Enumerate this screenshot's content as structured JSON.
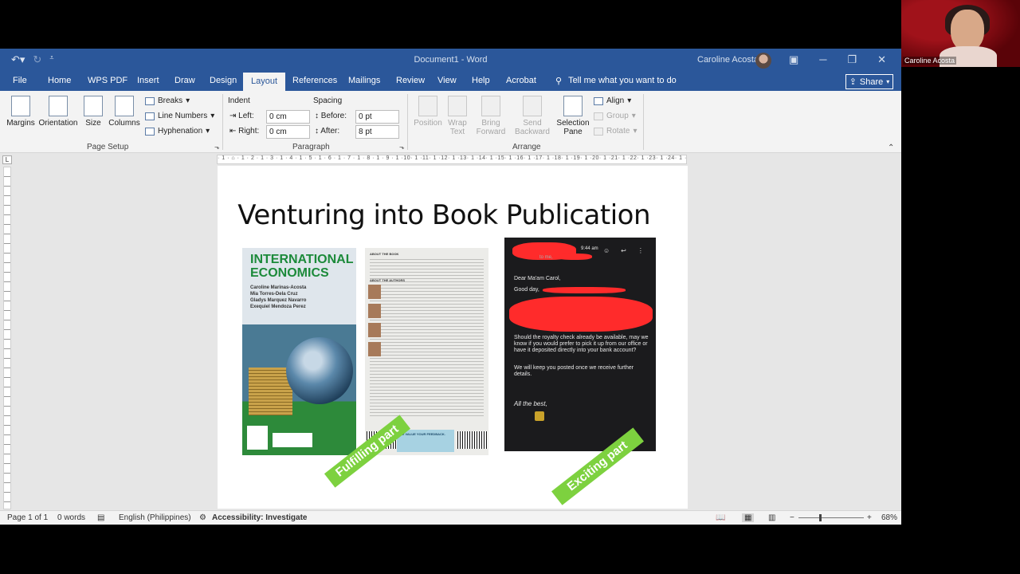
{
  "app": {
    "doc_title": "Document1  -  Word",
    "user_name": "Caroline Acosta"
  },
  "tabs": [
    "File",
    "Home",
    "WPS PDF",
    "Insert",
    "Draw",
    "Design",
    "Layout",
    "References",
    "Mailings",
    "Review",
    "View",
    "Help",
    "Acrobat"
  ],
  "tell_me": "Tell me what you want to do",
  "share_label": "Share",
  "ribbon": {
    "page_setup": {
      "group_label": "Page Setup",
      "margins": "Margins",
      "orientation": "Orientation",
      "size": "Size",
      "columns": "Columns",
      "breaks": "Breaks",
      "line_numbers": "Line Numbers",
      "hyphenation": "Hyphenation"
    },
    "paragraph": {
      "group_label": "Paragraph",
      "indent_label": "Indent",
      "spacing_label": "Spacing",
      "left_label": "Left:",
      "left_value": "0 cm",
      "right_label": "Right:",
      "right_value": "0 cm",
      "before_label": "Before:",
      "before_value": "0 pt",
      "after_label": "After:",
      "after_value": "8 pt"
    },
    "arrange": {
      "group_label": "Arrange",
      "position": "Position",
      "wrap_text_1": "Wrap",
      "wrap_text_2": "Text",
      "bring_forward_1": "Bring",
      "bring_forward_2": "Forward",
      "send_backward_1": "Send",
      "send_backward_2": "Backward",
      "selection_pane_1": "Selection",
      "selection_pane_2": "Pane",
      "align": "Align",
      "group": "Group",
      "rotate": "Rotate"
    }
  },
  "ruler_text": "· 1 · ⌂ · 1 · 2 · 1 · 3 · 1 · 4 · 1 · 5 · 1 · 6 · 1 · 7 · 1 · 8 · 1 · 9 · 1 ·10· 1 ·11· 1 ·12· 1 ·13· 1 ·14· 1 ·15· 1 ·16· 1 ·17· 1 ·18· 1 ·19· 1 ·20· 1 ·21· 1 ·22· 1 ·23· 1 ·24· 1 ·25· ·26",
  "document": {
    "heading": "Venturing into Book Publication",
    "cover": {
      "title": "INTERNATIONAL ECONOMICS",
      "authors": [
        "Caroline Marinas-Acosta",
        "Mia Torres-Dela Cruz",
        "Gladys Marquez Navarro",
        "Exequiel Mendoza Perez"
      ]
    },
    "back_cover": {
      "about_book": "ABOUT THE BOOK",
      "about_authors": "ABOUT THE AUTHORS",
      "feedback": "WE VALUE YOUR FEEDBACK."
    },
    "phone_message": {
      "time": "9:44 am",
      "to_me": "to me,",
      "greeting": "Dear Ma'am Carol,",
      "good_day": "Good day,",
      "body": "Should the royalty check already be available, may we know if you would prefer to pick it up from our office or have it deposited directly into your bank account?",
      "followup": "We will keep you posted once we receive further details.",
      "closing": "All the best,"
    },
    "sticker_1": "Fulfilling part",
    "sticker_2": "Exciting part",
    "paragraph_mark": "¶"
  },
  "status_bar": {
    "page": "Page 1 of 1",
    "words": "0 words",
    "language": "English (Philippines)",
    "accessibility": "Accessibility: Investigate",
    "zoom": "68%"
  },
  "webcam": {
    "name": "Caroline Acosta"
  },
  "colors": {
    "word_blue": "#2b579a",
    "sticker_green": "#7dd13f",
    "redaction_red": "#ff2b2b"
  }
}
